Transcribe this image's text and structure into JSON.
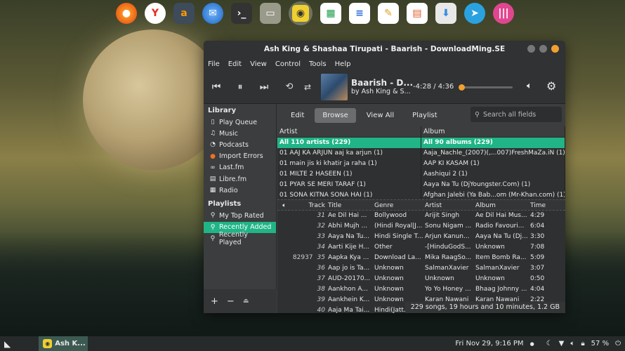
{
  "window": {
    "title": "Ash King & Shashaa Tirupati - Baarish -  DownloadMing.SE"
  },
  "menu": [
    "File",
    "Edit",
    "View",
    "Control",
    "Tools",
    "Help"
  ],
  "player": {
    "song_title": "Baarish -  D...",
    "artist_line": "by Ash King & S...",
    "time": "-4:28 / 4:36",
    "progress": 0.03
  },
  "sidebar": {
    "library_header": "Library",
    "library_items": [
      {
        "label": "Play Queue",
        "icon": "page-icon"
      },
      {
        "label": "Music",
        "icon": "music-note-icon"
      },
      {
        "label": "Podcasts",
        "icon": "rss-icon"
      },
      {
        "label": "Import Errors",
        "icon": "error-icon"
      },
      {
        "label": "Last.fm",
        "icon": "lastfm-icon"
      },
      {
        "label": "Libre.fm",
        "icon": "librefm-icon"
      },
      {
        "label": "Radio",
        "icon": "radio-icon"
      }
    ],
    "playlists_header": "Playlists",
    "playlist_items": [
      {
        "label": "My Top Rated"
      },
      {
        "label": "Recently Added"
      },
      {
        "label": "Recently Played"
      }
    ],
    "selected_playlist": "Recently Added"
  },
  "tabs": [
    "Edit",
    "Browse",
    "View All",
    "Playlist"
  ],
  "selected_tab": "Browse",
  "search": {
    "placeholder": "Search all fields"
  },
  "browser": {
    "artist_header": "Artist",
    "album_header": "Album",
    "artists": [
      "All 110 artists (229)",
      "01 AAJ KA ARJUN aaj ka arjun (1)",
      "01 main jis ki khatir ja raha (1)",
      "01 MILTE 2 HASEEN (1)",
      "01 PYAR SE MERI TARAF (1)",
      "01 SONA KITNA SONA HAI (1)"
    ],
    "albums": [
      "All 90 albums (229)",
      "Aaja_Nachle_(2007)(,...007)FreshMaZa.iN (1)",
      "AAP KI KASAM (1)",
      "Aashiqui 2 (1)",
      "Aaya Na Tu (DjYoungster.Com) (1)",
      "Afghan Jalebi (Ya Bab...om (Mr-Khan.com) (1)"
    ]
  },
  "tracks": {
    "headers": {
      "track": "Track",
      "title": "Title",
      "genre": "Genre",
      "artist": "Artist",
      "album": "Album",
      "time": "Time"
    },
    "rows": [
      {
        "pre": "",
        "track": "31",
        "title": "Ae Dil Hai ...",
        "genre": "Bollywood",
        "artist": "Arijit Singh",
        "album": "Ae Dil Hai Mus...",
        "time": "4:29"
      },
      {
        "pre": "",
        "track": "32",
        "title": "Abhi Mujh ...",
        "genre": "(Hindi Royal|J...",
        "artist": "Sonu Nigam ...",
        "album": "Radio Favouri...",
        "time": "6:04"
      },
      {
        "pre": "",
        "track": "33",
        "title": "Aaya Na Tu...",
        "genre": "Hindi Single T...",
        "artist": "Arjun Kanun...",
        "album": "Aaya Na Tu (Dj...",
        "time": "3:30"
      },
      {
        "pre": "",
        "track": "34",
        "title": "Aarti Kije H...",
        "genre": "Other",
        "artist": "-[HinduGodS...",
        "album": "Unknown",
        "time": "7:08"
      },
      {
        "pre": "82937",
        "track": "35",
        "title": "Aapka Kya ...",
        "genre": "Download La...",
        "artist": "Mika RaagSo...",
        "album": "Item Bomb Ra...",
        "time": "5:09"
      },
      {
        "pre": "",
        "track": "36",
        "title": "Aap jo is Ta...",
        "genre": "Unknown",
        "artist": "SalmanXavier",
        "album": "SalmanXavier",
        "time": "3:07"
      },
      {
        "pre": "",
        "track": "37",
        "title": "AUD-20170...",
        "genre": "Unknown",
        "artist": "Unknown",
        "album": "Unknown",
        "time": "0:50"
      },
      {
        "pre": "",
        "track": "38",
        "title": "Aankhon A...",
        "genre": "Unknown",
        "artist": "Yo Yo Honey ...",
        "album": "Bhaag Johnny ...",
        "time": "4:04"
      },
      {
        "pre": "",
        "track": "39",
        "title": "Aankhein K...",
        "genre": "Unknown",
        "artist": "Karan Nawani",
        "album": "Karan Nawani",
        "time": "2:22"
      },
      {
        "pre": "",
        "track": "40",
        "title": "Aaja Ma Tai...",
        "genre": "Hindi(Jatt.fm)",
        "artist": "",
        "album": "",
        "time": ""
      }
    ]
  },
  "status": "229 songs, 19 hours and 10 minutes, 1.2 GB",
  "taskbar": {
    "app_label": "Ash K...",
    "clock": "Fri Nov 29,  9:16 PM",
    "battery": "57 %"
  },
  "colors": {
    "accent": "#20b486",
    "orange": "#f0a030"
  }
}
